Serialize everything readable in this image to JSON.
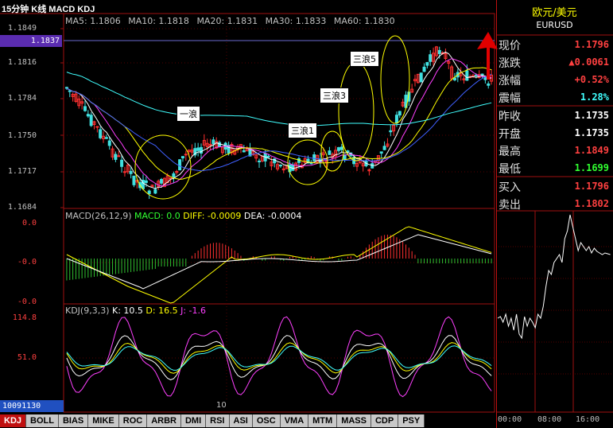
{
  "chart_title": "15分钟 K线 MACD KDJ",
  "ma_legend": [
    {
      "label": "MA5: 1.1806",
      "color": "#ffffff"
    },
    {
      "label": "MA10: 1.1818",
      "color": "#ff40ff"
    },
    {
      "label": "MA20: 1.1831",
      "color": "#ffff00"
    },
    {
      "label": "MA30: 1.1833",
      "color": "#4060ff"
    },
    {
      "label": "MA60: 1.1830",
      "color": "#40ffff"
    }
  ],
  "price_axis": [
    "1.1849",
    "1.1816",
    "1.1784",
    "1.1750",
    "1.1717",
    "1.1684"
  ],
  "price_badge": "1.1837",
  "wave_labels": [
    "一浪",
    "三浪1",
    "三浪3",
    "三浪5"
  ],
  "macd": {
    "name": "MACD(26,12,9)",
    "macd": "MACD: 0.0",
    "diff": "DIFF: -0.0009",
    "dea": "DEA: -0.0004",
    "axis": [
      "0.0",
      "-0.0",
      "-0.0"
    ]
  },
  "kdj": {
    "name": "KDJ(9,3,3)",
    "k": "K: 10.5",
    "d": "D: 16.5",
    "j": "J: -1.6",
    "axis": [
      "114.8",
      "51.0"
    ]
  },
  "date_box": "10091130",
  "x_label": "10",
  "tabs": [
    "KDJ",
    "BOLL",
    "BIAS",
    "MIKE",
    "ROC",
    "ARBR",
    "DMI",
    "RSI",
    "ASI",
    "OSC",
    "VMA",
    "MTM",
    "MASS",
    "CDP",
    "PSY"
  ],
  "quote": {
    "name": "欧元/美元",
    "code": "EURUSD",
    "rows": [
      {
        "label": "现价",
        "value": "1.1796",
        "color": "#ff4040"
      },
      {
        "label": "涨跌",
        "value": "▲0.0061",
        "color": "#ff4040"
      },
      {
        "label": "涨幅",
        "value": "+0.52%",
        "color": "#ff4040"
      },
      {
        "label": "震幅",
        "value": "1.28%",
        "color": "#40ffff"
      },
      {
        "label": "昨收",
        "value": "1.1735",
        "color": "#ffffff"
      },
      {
        "label": "开盘",
        "value": "1.1735",
        "color": "#ffffff"
      },
      {
        "label": "最高",
        "value": "1.1849",
        "color": "#ff4040"
      },
      {
        "label": "最低",
        "value": "1.1699",
        "color": "#30ff30"
      },
      {
        "label": "买入",
        "value": "1.1796",
        "color": "#ff4040"
      },
      {
        "label": "卖出",
        "value": "1.1802",
        "color": "#ff4040"
      }
    ]
  },
  "intraday_times": [
    "00:00",
    "08:00",
    "16:00"
  ]
}
